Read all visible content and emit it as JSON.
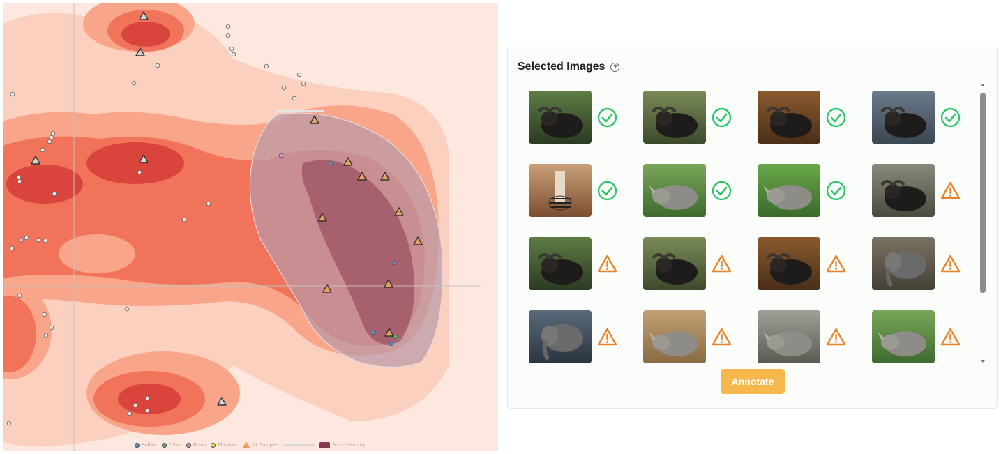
{
  "plot": {
    "legend": [
      {
        "label": "Buffalo",
        "color": "#5b8fc8",
        "shape": "circle"
      },
      {
        "label": "Zebra",
        "color": "#5cb85c",
        "shape": "circle"
      },
      {
        "label": "Rhino",
        "color": "#e58fc8",
        "shape": "circle"
      },
      {
        "label": "Elephant",
        "color": "#f3e44a",
        "shape": "circle"
      },
      {
        "label": "AL Samples",
        "color": "#e6a060",
        "shape": "triangle"
      },
      {
        "label": "",
        "color": "#d9d9d9",
        "shape": "bar"
      },
      {
        "label": "Score Heatmap",
        "color": "#8a3a50",
        "shape": "rect"
      }
    ],
    "colors": {
      "background": "#fde8e0",
      "light": "#fbd0be",
      "mid": "#f8a58a",
      "strong": "#f0735a",
      "dark": "#d9453d",
      "selection": "#b89aa8"
    }
  },
  "panel": {
    "title": "Selected Images",
    "help_icon": "question-circle-icon",
    "button_label": "Annotate",
    "images": [
      {
        "animal": "buffalo",
        "status": "annotated"
      },
      {
        "animal": "buffalo",
        "status": "annotated"
      },
      {
        "animal": "buffalo",
        "status": "annotated"
      },
      {
        "animal": "buffalo",
        "status": "annotated"
      },
      {
        "animal": "zebra",
        "status": "annotated"
      },
      {
        "animal": "rhino",
        "status": "annotated"
      },
      {
        "animal": "rhino",
        "status": "annotated"
      },
      {
        "animal": "buffalo",
        "status": "warning"
      },
      {
        "animal": "buffalo",
        "status": "warning"
      },
      {
        "animal": "buffalo",
        "status": "warning"
      },
      {
        "animal": "buffalo",
        "status": "warning"
      },
      {
        "animal": "elephant",
        "status": "warning"
      },
      {
        "animal": "elephant",
        "status": "warning"
      },
      {
        "animal": "rhino",
        "status": "warning"
      },
      {
        "animal": "rhino",
        "status": "warning"
      },
      {
        "animal": "rhino",
        "status": "warning"
      }
    ],
    "status_colors": {
      "annotated": "#2ec46a",
      "warning": "#e8832a"
    },
    "button_color": "#f6b84c"
  }
}
